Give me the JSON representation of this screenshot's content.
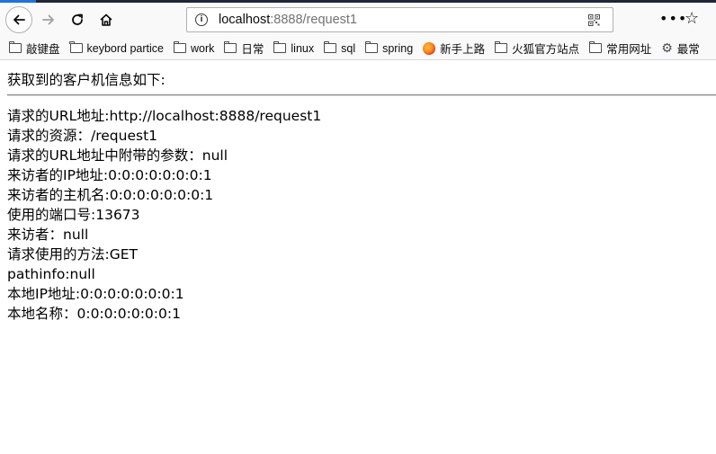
{
  "browser": {
    "url_host": "localhost",
    "url_rest": ":8888/request1",
    "more_glyph": "•••",
    "star_glyph": "☆"
  },
  "bookmarks": [
    {
      "label": "敲键盘",
      "icon": "folder-icon"
    },
    {
      "label": "keybord partice",
      "icon": "folder-icon"
    },
    {
      "label": "work",
      "icon": "folder-icon"
    },
    {
      "label": "日常",
      "icon": "folder-icon"
    },
    {
      "label": "linux",
      "icon": "folder-icon"
    },
    {
      "label": "sql",
      "icon": "folder-icon"
    },
    {
      "label": "spring",
      "icon": "folder-icon"
    },
    {
      "label": "新手上路",
      "icon": "firefox-icon"
    },
    {
      "label": "火狐官方站点",
      "icon": "folder-icon"
    },
    {
      "label": "常用网址",
      "icon": "folder-icon"
    },
    {
      "label": "最常",
      "icon": "gear-icon"
    }
  ],
  "page": {
    "heading": "获取到的客户机信息如下:",
    "lines": [
      "请求的URL地址:http://localhost:8888/request1",
      "请求的资源：/request1",
      "请求的URL地址中附带的参数：null",
      "来访者的IP地址:0:0:0:0:0:0:0:1",
      "来访者的主机名:0:0:0:0:0:0:0:1",
      "使用的端口号:13673",
      "来访者：null",
      "请求使用的方法:GET",
      "pathinfo:null",
      "本地IP地址:0:0:0:0:0:0:0:1",
      "本地名称：0:0:0:0:0:0:0:1"
    ]
  }
}
